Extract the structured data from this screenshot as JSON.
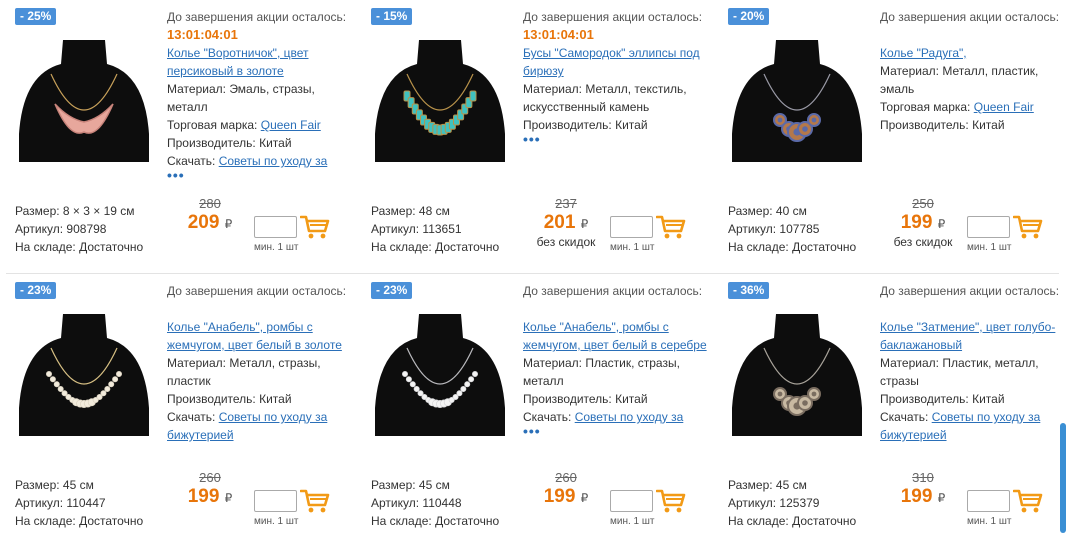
{
  "promo_label": "До завершения акции осталось:",
  "labels": {
    "size": "Размер:",
    "article": "Артикул:",
    "stock": "На складе:",
    "material": "Материал:",
    "brand": "Торговая марка:",
    "maker": "Производитель:",
    "download": "Скачать:",
    "min_qty": "мин. 1 шт",
    "currency": "₽",
    "no_discount": "без скидок"
  },
  "products": [
    {
      "badge": "- 25%",
      "timer": "13:01:04:01",
      "title": "Колье \"Воротничок\", цвет персиковый в золоте",
      "material": "Эмаль, стразы, металл",
      "brand": "Queen Fair",
      "maker": "Китай",
      "download": "Советы по уходу за",
      "dots": "•••",
      "size": "8 × 3 × 19 см",
      "article": "908798",
      "stock": "Достаточно",
      "old_price": "280",
      "price": "209",
      "no_discount": false
    },
    {
      "badge": "- 15%",
      "timer": "13:01:04:01",
      "title": "Бусы \"Самородок\" эллипсы под бирюзу",
      "material": "Металл, текстиль, искусственный камень",
      "maker": "Китай",
      "dots": "•••",
      "size": "48 см",
      "article": "113651",
      "stock": "Достаточно",
      "old_price": "237",
      "price": "201",
      "no_discount": true
    },
    {
      "badge": "- 20%",
      "timer": "",
      "title": "Колье \"Радуга\",",
      "material": "Металл, пластик, эмаль",
      "brand": "Queen Fair",
      "maker": "Китай",
      "size": "40 см",
      "article": "107785",
      "stock": "Достаточно",
      "old_price": "250",
      "price": "199",
      "no_discount": true
    },
    {
      "badge": "- 23%",
      "timer": "",
      "title": "Колье \"Анабель\", ромбы с жемчугом, цвет белый в золоте",
      "material": "Металл, стразы, пластик",
      "maker": "Китай",
      "download": "Советы по уходу за бижутерией",
      "size": "45 см",
      "article": "110447",
      "stock": "Достаточно",
      "old_price": "260",
      "price": "199",
      "no_discount": false
    },
    {
      "badge": "- 23%",
      "timer": "",
      "title": "Колье \"Анабель\", ромбы с жемчугом, цвет белый в серебре",
      "material": "Пластик, стразы, металл",
      "maker": "Китай",
      "download": "Советы по уходу за",
      "dots": "•••",
      "size": "45 см",
      "article": "110448",
      "stock": "Достаточно",
      "old_price": "260",
      "price": "199",
      "no_discount": false
    },
    {
      "badge": "- 36%",
      "timer": "",
      "title": "Колье \"Затмение\", цвет голубо-баклажановый",
      "material": "Пластик, металл, стразы",
      "maker": "Китай",
      "download": "Советы по уходу за бижутерией",
      "size": "45 см",
      "article": "125379",
      "stock": "Достаточно",
      "old_price": "310",
      "price": "199",
      "no_discount": false
    }
  ],
  "colors": {
    "accent_price": "#e8750a",
    "link": "#2a6fb8",
    "badge": "#4a90d9"
  },
  "icons": [
    "cart-icon",
    "necklace-photo"
  ]
}
